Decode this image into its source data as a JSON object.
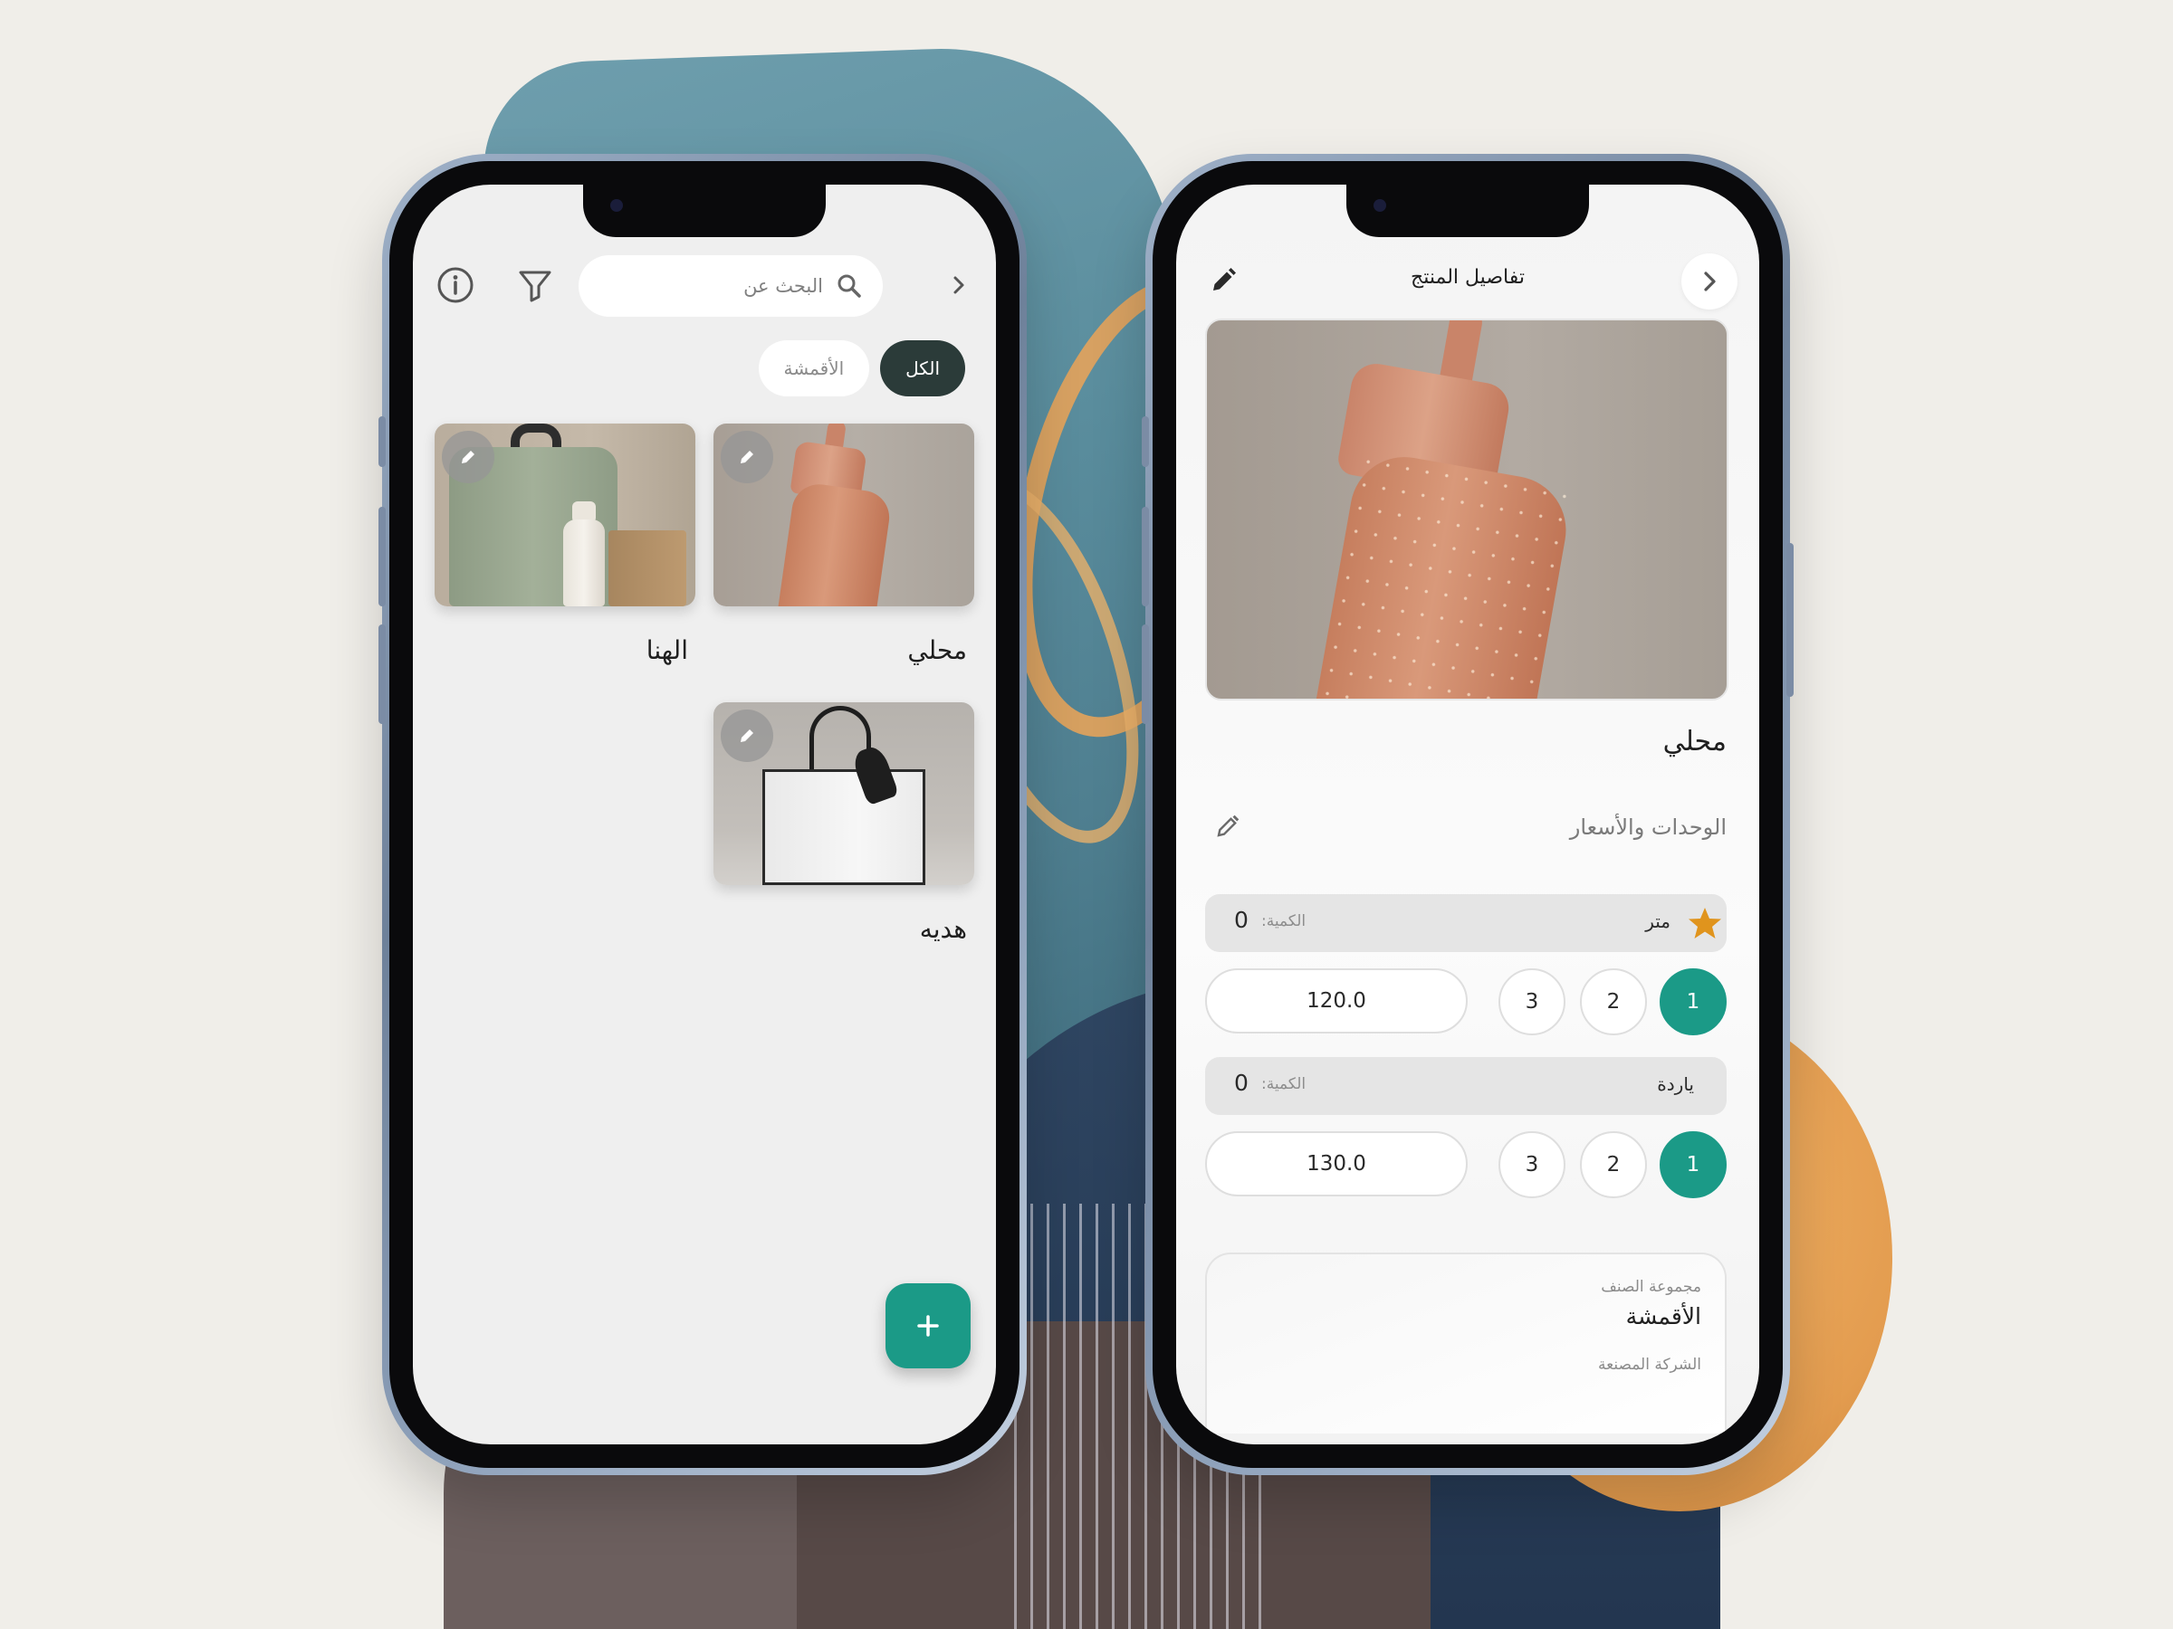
{
  "left_screen": {
    "search": {
      "placeholder": "البحث عن"
    },
    "icons": {
      "info": "info-icon",
      "filter": "filter-icon",
      "search": "search-icon",
      "forward": "chevron-right-icon",
      "add": "plus-icon",
      "edit": "pencil-icon"
    },
    "chips": [
      {
        "label": "الكل",
        "selected": true
      },
      {
        "label": "الأقمشة",
        "selected": false
      }
    ],
    "products": [
      {
        "name": "محلي",
        "image": "peach-bottle"
      },
      {
        "name": "الهنا",
        "image": "green-backpack-with-bottle"
      },
      {
        "name": "هديه",
        "image": "white-gift-bag"
      }
    ],
    "colors": {
      "accent": "#1b9a87",
      "chip_active": "#2b3b39"
    }
  },
  "right_screen": {
    "header": {
      "title": "تفاصيل المنتج"
    },
    "product": {
      "name": "محلي",
      "image": "peach-bottle"
    },
    "units_section": {
      "label": "الوحدات والأسعار"
    },
    "units": [
      {
        "name": "متر",
        "default": true,
        "quantity_label": "الكمية:",
        "quantity": "0",
        "price": "120.0",
        "levels": [
          "1",
          "2",
          "3"
        ],
        "selected_level": "1"
      },
      {
        "name": "ياردة",
        "default": false,
        "quantity_label": "الكمية:",
        "quantity": "0",
        "price": "130.0",
        "levels": [
          "1",
          "2",
          "3"
        ],
        "selected_level": "1"
      }
    ],
    "info": {
      "group_label": "مجموعة الصنف",
      "group_value": "الأقمشة",
      "manufacturer_label": "الشركة المصنعة"
    },
    "colors": {
      "accent": "#1b9a87",
      "star": "#e0941d"
    }
  }
}
